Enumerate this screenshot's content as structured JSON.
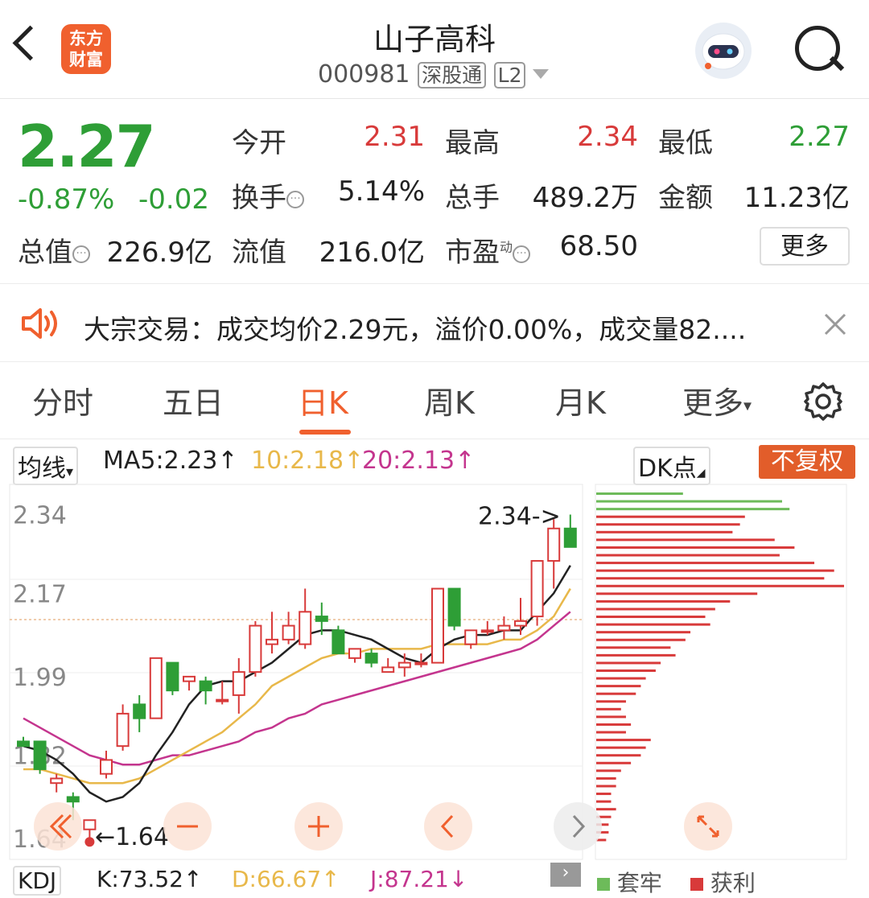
{
  "header": {
    "logo_line1": "东方",
    "logo_line2": "财富",
    "title": "山子高科",
    "code": "000981",
    "tag1": "深股通",
    "tag2": "L2"
  },
  "quote": {
    "price": "2.27",
    "change_pct": "-0.87%",
    "change": "-0.02",
    "rows": [
      [
        {
          "label": "今开",
          "value": "2.31",
          "color": "red"
        },
        {
          "label": "最高",
          "value": "2.34",
          "color": "red"
        },
        {
          "label": "最低",
          "value": "2.27",
          "color": "green"
        }
      ],
      [
        {
          "label": "换手",
          "value": "5.14%",
          "color": "black"
        },
        {
          "label": "总手",
          "value": "489.2万",
          "color": "black"
        },
        {
          "label": "金额",
          "value": "11.23亿",
          "color": "black"
        }
      ]
    ],
    "mcap_label": "总值",
    "mcap_value": "226.9亿",
    "float_label": "流值",
    "float_value": "216.0亿",
    "pe_label": "市盈",
    "pe_sup": "动",
    "pe_value": "68.50",
    "more_label": "更多"
  },
  "notice": {
    "text": "大宗交易：成交均价2.29元，溢价0.00%，成交量82...."
  },
  "tabs": [
    "分时",
    "五日",
    "日K",
    "周K",
    "月K",
    "更多"
  ],
  "active_tab": "日K",
  "ma": {
    "select": "均线",
    "ma5": "MA5:2.23",
    "ma10": "10:2.18",
    "ma20": "20:2.13",
    "dk": "DK点",
    "adjust": "不复权"
  },
  "kdj": {
    "select": "KDJ",
    "k": "K:73.52",
    "d": "D:66.67",
    "j": "J:87.21"
  },
  "legend": {
    "lock": "套牢",
    "profit": "获利"
  },
  "colors": {
    "up": "#d83a3a",
    "down": "#2e9e36",
    "ma5": "#222222",
    "ma10": "#e8b84a",
    "ma20": "#c4358e",
    "accent": "#f0602e"
  },
  "chart_data": {
    "type": "candlestick",
    "y_ticks": [
      "2.34",
      "2.17",
      "1.99",
      "1.82",
      "1.64"
    ],
    "ylim": [
      1.63,
      2.36
    ],
    "high_label": "2.34->",
    "low_label": "1.64",
    "candles": [
      {
        "o": 1.85,
        "h": 1.86,
        "l": 1.84,
        "c": 1.84
      },
      {
        "o": 1.85,
        "h": 1.85,
        "l": 1.78,
        "c": 1.79
      },
      {
        "o": 1.76,
        "h": 1.78,
        "l": 1.74,
        "c": 1.77
      },
      {
        "o": 1.73,
        "h": 1.74,
        "l": 1.68,
        "c": 1.72
      },
      {
        "o": 1.66,
        "h": 1.68,
        "l": 1.64,
        "c": 1.68
      },
      {
        "o": 1.78,
        "h": 1.83,
        "l": 1.77,
        "c": 1.81
      },
      {
        "o": 1.84,
        "h": 1.93,
        "l": 1.83,
        "c": 1.91
      },
      {
        "o": 1.93,
        "h": 1.95,
        "l": 1.87,
        "c": 1.9
      },
      {
        "o": 1.9,
        "h": 2.03,
        "l": 1.9,
        "c": 2.03
      },
      {
        "o": 2.02,
        "h": 2.02,
        "l": 1.95,
        "c": 1.96
      },
      {
        "o": 1.98,
        "h": 1.99,
        "l": 1.96,
        "c": 1.99
      },
      {
        "o": 1.98,
        "h": 1.99,
        "l": 1.93,
        "c": 1.96
      },
      {
        "o": 1.94,
        "h": 1.98,
        "l": 1.93,
        "c": 1.94
      },
      {
        "o": 1.95,
        "h": 2.03,
        "l": 1.91,
        "c": 2.0
      },
      {
        "o": 2.0,
        "h": 2.11,
        "l": 1.99,
        "c": 2.1
      },
      {
        "o": 2.06,
        "h": 2.13,
        "l": 2.04,
        "c": 2.07
      },
      {
        "o": 2.07,
        "h": 2.13,
        "l": 2.06,
        "c": 2.1
      },
      {
        "o": 2.06,
        "h": 2.18,
        "l": 2.05,
        "c": 2.13
      },
      {
        "o": 2.12,
        "h": 2.15,
        "l": 2.08,
        "c": 2.11
      },
      {
        "o": 2.09,
        "h": 2.1,
        "l": 2.04,
        "c": 2.04
      },
      {
        "o": 2.03,
        "h": 2.05,
        "l": 2.02,
        "c": 2.05
      },
      {
        "o": 2.04,
        "h": 2.05,
        "l": 2.01,
        "c": 2.02
      },
      {
        "o": 2.0,
        "h": 2.03,
        "l": 2.0,
        "c": 2.01
      },
      {
        "o": 2.01,
        "h": 2.04,
        "l": 1.99,
        "c": 2.02
      },
      {
        "o": 2.02,
        "h": 2.04,
        "l": 2.01,
        "c": 2.02
      },
      {
        "o": 2.02,
        "h": 2.18,
        "l": 2.02,
        "c": 2.18
      },
      {
        "o": 2.18,
        "h": 2.18,
        "l": 2.09,
        "c": 2.1
      },
      {
        "o": 2.06,
        "h": 2.09,
        "l": 2.05,
        "c": 2.09
      },
      {
        "o": 2.09,
        "h": 2.11,
        "l": 2.08,
        "c": 2.09
      },
      {
        "o": 2.09,
        "h": 2.12,
        "l": 2.07,
        "c": 2.1
      },
      {
        "o": 2.1,
        "h": 2.16,
        "l": 2.08,
        "c": 2.11
      },
      {
        "o": 2.12,
        "h": 2.24,
        "l": 2.1,
        "c": 2.24
      },
      {
        "o": 2.24,
        "h": 2.33,
        "l": 2.18,
        "c": 2.31
      },
      {
        "o": 2.31,
        "h": 2.34,
        "l": 2.27,
        "c": 2.27
      }
    ],
    "ma5": [
      1.84,
      1.83,
      1.81,
      1.78,
      1.74,
      1.72,
      1.73,
      1.76,
      1.82,
      1.87,
      1.93,
      1.97,
      1.98,
      1.98,
      2.0,
      2.02,
      2.05,
      2.08,
      2.09,
      2.09,
      2.08,
      2.07,
      2.05,
      2.03,
      2.02,
      2.05,
      2.07,
      2.08,
      2.08,
      2.09,
      2.09,
      2.13,
      2.17,
      2.23
    ],
    "ma10": [
      1.79,
      1.79,
      1.78,
      1.77,
      1.76,
      1.76,
      1.76,
      1.77,
      1.79,
      1.81,
      1.83,
      1.85,
      1.87,
      1.9,
      1.93,
      1.97,
      1.99,
      2.01,
      2.03,
      2.04,
      2.04,
      2.05,
      2.05,
      2.05,
      2.05,
      2.06,
      2.06,
      2.06,
      2.06,
      2.07,
      2.07,
      2.09,
      2.12,
      2.18
    ],
    "ma20": [
      1.9,
      1.88,
      1.86,
      1.84,
      1.82,
      1.81,
      1.8,
      1.8,
      1.81,
      1.82,
      1.82,
      1.83,
      1.84,
      1.85,
      1.87,
      1.88,
      1.9,
      1.91,
      1.93,
      1.94,
      1.95,
      1.96,
      1.97,
      1.98,
      1.99,
      2.0,
      2.01,
      2.02,
      2.03,
      2.04,
      2.05,
      2.07,
      2.1,
      2.13
    ],
    "volume_profile": [
      0.35,
      0.75,
      0.78,
      0.6,
      0.58,
      0.55,
      0.72,
      0.8,
      0.74,
      0.88,
      0.96,
      0.92,
      1.0,
      0.65,
      0.54,
      0.48,
      0.44,
      0.46,
      0.38,
      0.36,
      0.3,
      0.32,
      0.26,
      0.24,
      0.2,
      0.18,
      0.16,
      0.12,
      0.1,
      0.12,
      0.14,
      0.12,
      0.22,
      0.2,
      0.18,
      0.14,
      0.1,
      0.08,
      0.08,
      0.06,
      0.06,
      0.08,
      0.06,
      0.05,
      0.05,
      0.04
    ],
    "volume_profile_green_rows": 3
  }
}
